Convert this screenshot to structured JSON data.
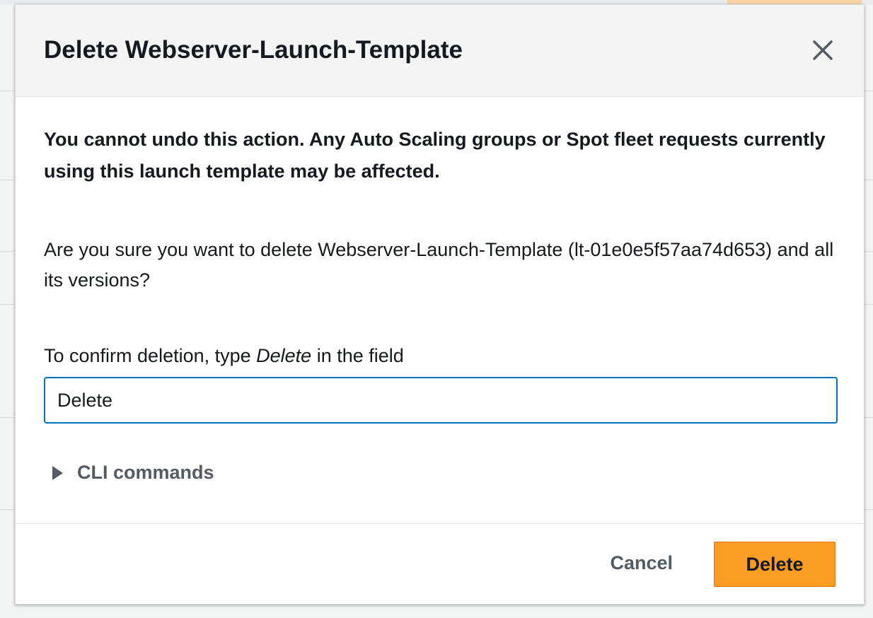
{
  "modal": {
    "title": "Delete Webserver-Launch-Template",
    "warning": "You cannot undo this action. Any Auto Scaling groups or Spot fleet requests currently using this launch template may be affected.",
    "question": "Are you sure you want to delete Webserver-Launch-Template (lt-01e0e5f57aa74d653) and all its versions?",
    "confirm_prefix": "To confirm deletion, type ",
    "confirm_keyword": "Delete",
    "confirm_suffix": " in the field",
    "confirm_input_value": "Delete",
    "cli_label": "CLI commands",
    "cancel_label": "Cancel",
    "delete_label": "Delete"
  },
  "icons": {
    "close": "close-icon",
    "cli_caret": "caret-right-icon"
  },
  "colors": {
    "primary_button": "#f89c24",
    "input_focus_border": "#0073bb",
    "secondary_text": "#545b64"
  }
}
